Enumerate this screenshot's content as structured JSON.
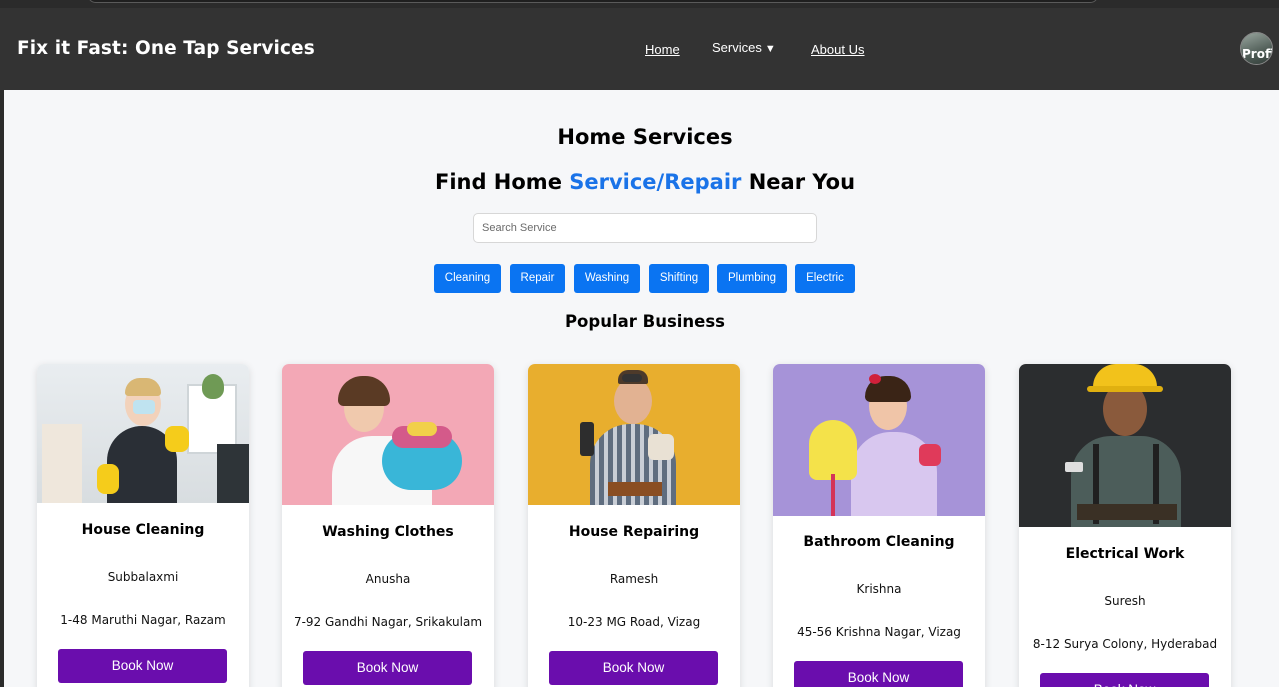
{
  "app": {
    "brand": "Fix it Fast: One Tap Services"
  },
  "nav": {
    "home": "Home",
    "services": "Services",
    "services_caret": "▼",
    "about": "About Us",
    "avatar_text": "Profi"
  },
  "hero": {
    "title": "Home Services",
    "subtitle_pre": "Find Home ",
    "subtitle_accent": "Service/Repair",
    "subtitle_post": " Near You",
    "accent_color": "#1a73e8",
    "search_placeholder": "Search Service"
  },
  "categories": [
    "Cleaning",
    "Repair",
    "Washing",
    "Shifting",
    "Plumbing",
    "Electric"
  ],
  "popular": {
    "heading": "Popular Business",
    "cards": [
      {
        "title": "House Cleaning",
        "owner": "Subbalaxmi",
        "address": "1-48 Maruthi Nagar, Razam",
        "button": "Book Now",
        "image_icon": "cleaning-lady-photo"
      },
      {
        "title": "Washing Clothes",
        "owner": "Anusha",
        "address": "7-92 Gandhi Nagar, Srikakulam",
        "button": "Book Now",
        "image_icon": "laundry-woman-photo"
      },
      {
        "title": "House Repairing",
        "owner": "Ramesh",
        "address": "10-23 MG Road, Vizag",
        "button": "Book Now",
        "image_icon": "repairman-photo"
      },
      {
        "title": "Bathroom Cleaning",
        "owner": "Krishna",
        "address": "45-56 Krishna Nagar, Vizag",
        "button": "Book Now",
        "image_icon": "mop-woman-photo"
      },
      {
        "title": "Electrical Work",
        "owner": "Suresh",
        "address": "8-12 Surya Colony, Hyderabad",
        "button": "Book Now",
        "image_icon": "electrician-photo"
      }
    ]
  },
  "colors": {
    "navbar": "#333333",
    "chip": "#0a74f2",
    "book_button": "#6a0dad",
    "page_bg": "#f6f7f9"
  }
}
